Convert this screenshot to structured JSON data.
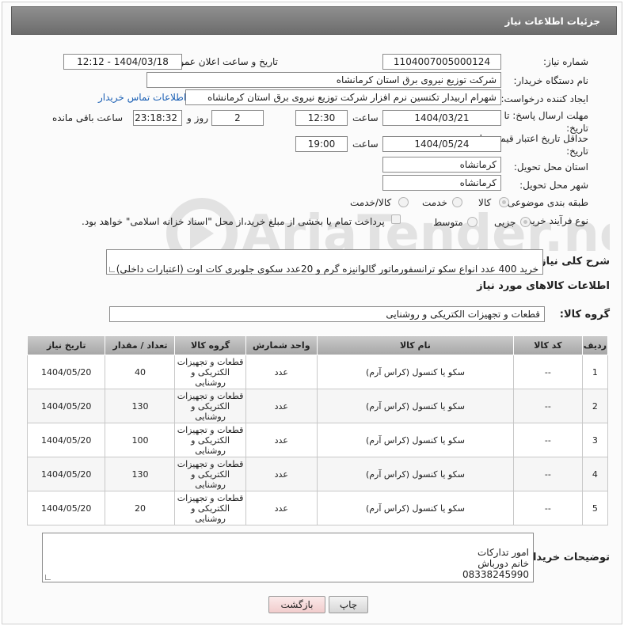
{
  "header": {
    "title": "جزئیات اطلاعات نیاز"
  },
  "fields": {
    "need_number_label": "شماره نیاز:",
    "need_number": "1104007005000124",
    "announce_label": "تاریخ و ساعت اعلان عمومی:",
    "announce_value": "1404/03/18 - 12:12",
    "buyer_org_label": "نام دستگاه خریدار:",
    "buyer_org": "شرکت توزیع نیروی برق استان کرمانشاه",
    "requester_label": "ایجاد کننده درخواست:",
    "requester": "شهرام اربیدار تکنسین نرم افزار شرکت توزیع نیروی برق استان کرمانشاه",
    "contact_link": "اطلاعات تماس خریدار",
    "deadline_label": "مهلت ارسال پاسخ: تا تاریخ:",
    "deadline_date": "1404/03/21",
    "time_label": "ساعت",
    "deadline_time": "12:30",
    "days": "2",
    "days_label": "روز و",
    "remaining": "23:18:32",
    "remaining_label": "ساعت باقی مانده",
    "price_validity_label": "حداقل تاریخ اعتبار قیمت: تا تاریخ:",
    "price_validity_date": "1404/05/24",
    "price_validity_time": "19:00",
    "province_label": "استان محل تحویل:",
    "province": "کرمانشاه",
    "city_label": "شهر محل تحویل:",
    "city": "کرمانشاه",
    "category_label": "طبقه بندی موضوعی:",
    "category_options": [
      "کالا",
      "خدمت",
      "کالا/خدمت"
    ],
    "purchase_type_label": "نوع فرآیند خرید :",
    "purchase_options": [
      "جزیی",
      "متوسط"
    ],
    "payment_note": "پرداخت تمام یا بخشی از مبلغ خرید،از محل \"اسناد خزانه اسلامی\" خواهد بود."
  },
  "description": {
    "label": "شرح کلی نیاز:",
    "text": "خرید 400 عدد انواع سکو ترانسفورماتور گالوانیزه گرم و 20عدد سکوی جلوبری کات اوت (اعتبارات داخلی)"
  },
  "goods_info": {
    "title": "اطلاعات کالاهای مورد نیاز",
    "group_label": "گروه کالا:",
    "group_value": "قطعات و تجهیزات الکتریکی و روشنایی"
  },
  "table": {
    "headers": [
      "ردیف",
      "کد کالا",
      "نام کالا",
      "واحد شمارش",
      "گروه کالا",
      "تعداد / مقدار",
      "تاریخ نیاز"
    ],
    "rows": [
      [
        "1",
        "--",
        "سکو یا کنسول (کراس آرم)",
        "عدد",
        "قطعات و تجهیزات الکتریکی و روشنایی",
        "40",
        "1404/05/20"
      ],
      [
        "2",
        "--",
        "سکو یا کنسول (کراس آرم)",
        "عدد",
        "قطعات و تجهیزات الکتریکی و روشنایی",
        "130",
        "1404/05/20"
      ],
      [
        "3",
        "--",
        "سکو یا کنسول (کراس آرم)",
        "عدد",
        "قطعات و تجهیزات الکتریکی و روشنایی",
        "100",
        "1404/05/20"
      ],
      [
        "4",
        "--",
        "سکو یا کنسول (کراس آرم)",
        "عدد",
        "قطعات و تجهیزات الکتریکی و روشنایی",
        "130",
        "1404/05/20"
      ],
      [
        "5",
        "--",
        "سکو یا کنسول (کراس آرم)",
        "عدد",
        "قطعات و تجهیزات الکتریکی و روشنایی",
        "20",
        "1404/05/20"
      ]
    ]
  },
  "buyer_notes": {
    "label": "توضیحات خریدار:",
    "text": "امور تدارکات\nخانم دورباش\n08338245990"
  },
  "buttons": {
    "print": "چاپ",
    "back": "بازگشت"
  },
  "watermark": "AriaTender.net"
}
